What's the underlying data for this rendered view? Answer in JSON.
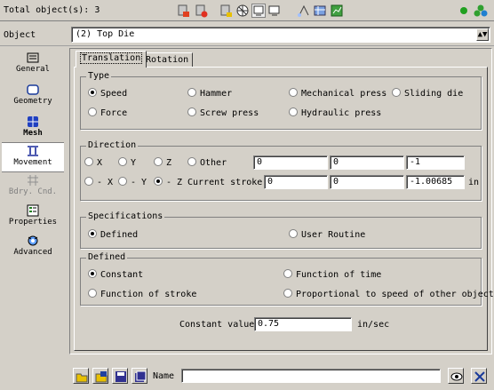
{
  "topbar": {
    "total_objects": "Total object(s): 3"
  },
  "object_row": {
    "label": "Object",
    "selected": "(2) Top Die"
  },
  "sidebar": {
    "items": [
      {
        "label": "General",
        "icon": "general-icon",
        "state": "normal"
      },
      {
        "label": "Geometry",
        "icon": "geometry-icon",
        "state": "normal"
      },
      {
        "label": "Mesh",
        "icon": "mesh-icon",
        "state": "normal"
      },
      {
        "label": "Movement",
        "icon": "movement-icon",
        "state": "active"
      },
      {
        "label": "Bdry. Cnd.",
        "icon": "boundary-condition-icon",
        "state": "disabled"
      },
      {
        "label": "Properties",
        "icon": "properties-icon",
        "state": "normal"
      },
      {
        "label": "Advanced",
        "icon": "advanced-icon",
        "state": "normal"
      }
    ]
  },
  "tabs": [
    {
      "label": "Translation",
      "selected": true
    },
    {
      "label": "Rotation",
      "selected": false
    }
  ],
  "type_group": {
    "legend": "Type",
    "options": {
      "speed": "Speed",
      "hammer": "Hammer",
      "mech_press": "Mechanical press",
      "sliding_die": "Sliding die",
      "force": "Force",
      "screw_press": "Screw press",
      "hydraulic_press": "Hydraulic press"
    },
    "selected": "Speed"
  },
  "direction_group": {
    "legend": "Direction",
    "opt_x": "X",
    "opt_y": "Y",
    "opt_z": "Z",
    "opt_other": "Other",
    "opt_neg_x": "- X",
    "opt_neg_y": "- Y",
    "opt_neg_z": "- Z",
    "selected": "- Z",
    "other_values": [
      "0",
      "0",
      "-1"
    ],
    "current_stroke_label": "Current stroke",
    "stroke_values": [
      "0",
      "0",
      "-1.00685"
    ],
    "unit": "in"
  },
  "spec_group": {
    "legend": "Specifications",
    "defined": "Defined",
    "user_routine": "User Routine",
    "selected": "Defined"
  },
  "defined_group": {
    "legend": "Defined",
    "constant": "Constant",
    "function_of_time": "Function of time",
    "function_of_stroke": "Function of stroke",
    "proportional": "Proportional to speed of other object",
    "selected": "Constant"
  },
  "constant_value": {
    "label": "Constant value",
    "value": "0.75",
    "unit": "in/sec"
  },
  "bottombar": {
    "name_label": "Name",
    "name_value": ""
  },
  "colors": {
    "background": "#d4d0c8",
    "active_bg": "#ffffff",
    "disabled_text": "#808080"
  }
}
